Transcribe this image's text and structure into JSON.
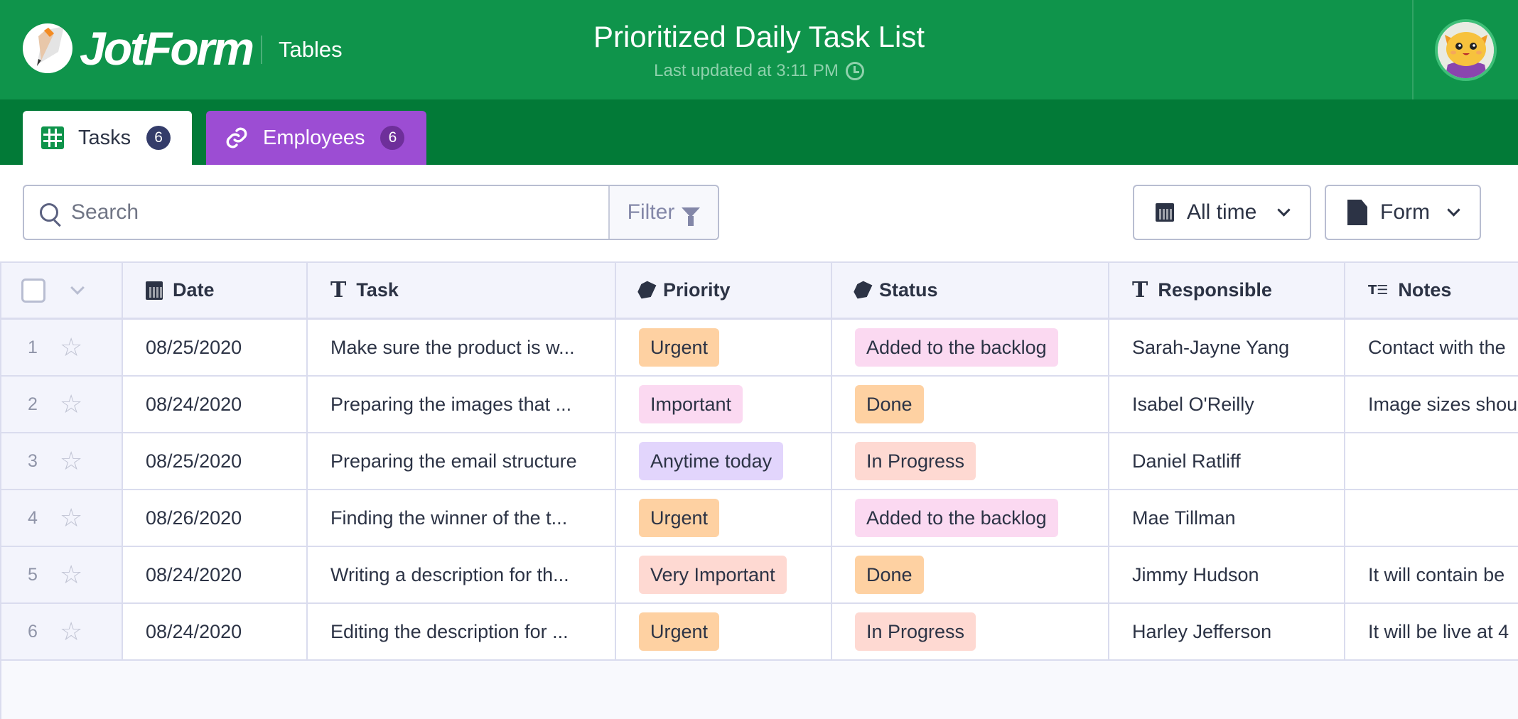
{
  "header": {
    "brand": "JotForm",
    "product": "Tables",
    "title": "Prioritized Daily Task List",
    "last_updated": "Last updated at 3:11 PM",
    "avatar_icon": "user-avatar-cat"
  },
  "tabs": [
    {
      "label": "Tasks",
      "count": "6",
      "icon": "table-grid-icon",
      "active": true
    },
    {
      "label": "Employees",
      "count": "6",
      "icon": "link-icon",
      "active": false
    }
  ],
  "toolbar": {
    "search_placeholder": "Search",
    "search_value": "",
    "filter_label": "Filter",
    "date_range": "All time",
    "view_type": "Form"
  },
  "table": {
    "columns": [
      {
        "label": "Date",
        "icon": "calendar-icon"
      },
      {
        "label": "Task",
        "icon": "text-icon"
      },
      {
        "label": "Priority",
        "icon": "tag-icon"
      },
      {
        "label": "Status",
        "icon": "tag-icon"
      },
      {
        "label": "Responsible",
        "icon": "text-icon"
      },
      {
        "label": "Notes",
        "icon": "long-text-icon"
      }
    ],
    "rows": [
      {
        "num": "1",
        "date": "08/25/2020",
        "task": "Make sure the product is w...",
        "priority": "Urgent",
        "status": "Added to the backlog",
        "responsible": "Sarah-Jayne Yang",
        "notes": "Contact with the"
      },
      {
        "num": "2",
        "date": "08/24/2020",
        "task": "Preparing the images that ...",
        "priority": "Important",
        "status": "Done",
        "responsible": "Isabel O'Reilly",
        "notes": "Image sizes shou"
      },
      {
        "num": "3",
        "date": "08/25/2020",
        "task": "Preparing the email structure",
        "priority": "Anytime today",
        "status": "In Progress",
        "responsible": "Daniel Ratliff",
        "notes": ""
      },
      {
        "num": "4",
        "date": "08/26/2020",
        "task": "Finding the winner of the t...",
        "priority": "Urgent",
        "status": "Added to the backlog",
        "responsible": "Mae Tillman",
        "notes": ""
      },
      {
        "num": "5",
        "date": "08/24/2020",
        "task": "Writing a description for th...",
        "priority": "Very Important",
        "status": "Done",
        "responsible": "Jimmy Hudson",
        "notes": "It will contain be"
      },
      {
        "num": "6",
        "date": "08/24/2020",
        "task": "Editing the description for ...",
        "priority": "Urgent",
        "status": "In Progress",
        "responsible": "Harley Jefferson",
        "notes": "It will be live at 4"
      }
    ]
  },
  "colors": {
    "header_bg": "#0f944b",
    "tabbar_bg": "#027a37",
    "employees_tab": "#9c4dd3",
    "pill_colors": {
      "Urgent": "#fed1a2",
      "Important": "#fbd9f1",
      "Anytime today": "#e2d5fc",
      "Very Important": "#fed9d2",
      "Added to the backlog": "#fbd9f1",
      "Done": "#fed1a2",
      "In Progress": "#fed9d2"
    }
  }
}
